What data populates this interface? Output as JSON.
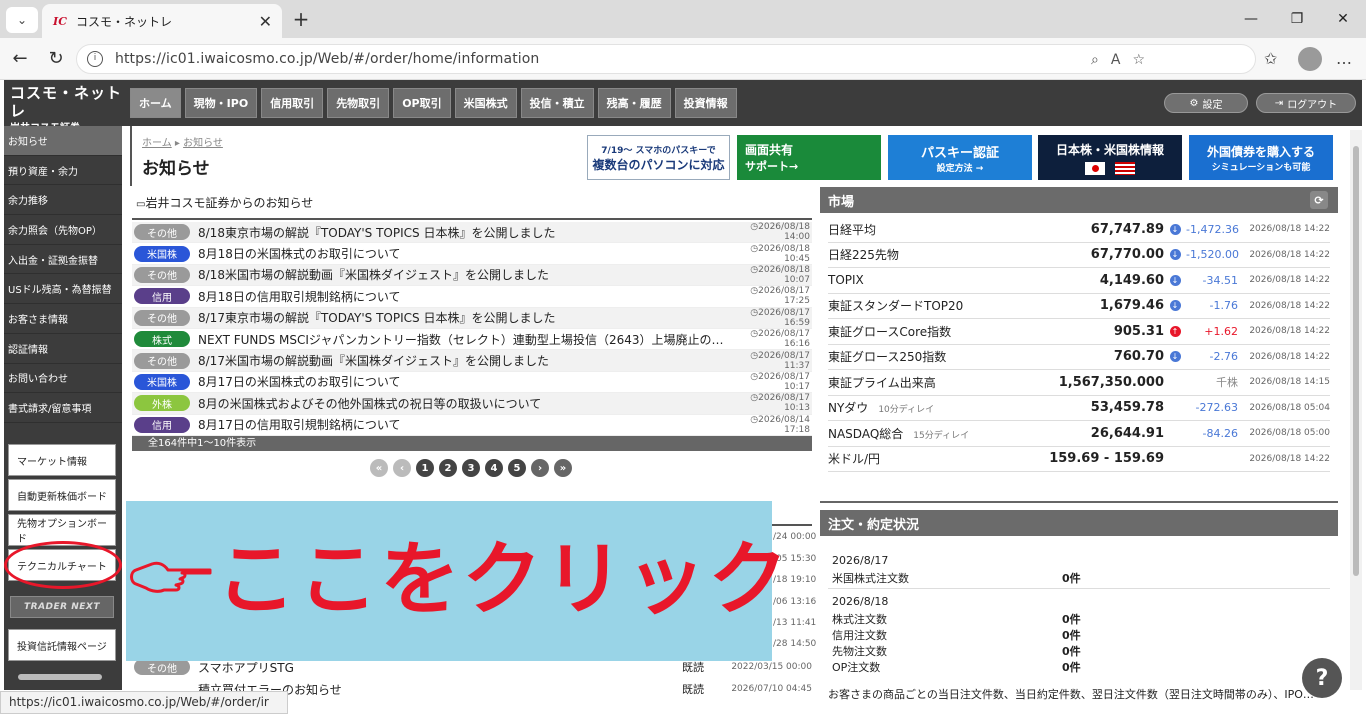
{
  "browser": {
    "tab_title": "コスモ・ネットレ",
    "url": "https://ic01.iwaicosmo.co.jp/Web/#/order/home/information",
    "status_url": "https://ic01.iwaicosmo.co.jp/Web/#/order/ir"
  },
  "header": {
    "logo_line1": "コスモ・ネットレ",
    "logo_line2": "岩井コスモ証券",
    "nav": [
      "ホーム",
      "現物・IPO",
      "信用取引",
      "先物取引",
      "OP取引",
      "米国株式",
      "投信・積立",
      "残高・履歴",
      "投資情報"
    ],
    "settings_label": "設定",
    "logout_label": "ログアウト"
  },
  "sidebar": {
    "items": [
      "お知らせ",
      "預り資産・余力",
      "余力推移",
      "余力照会（先物OP）",
      "入出金・証拠金振替",
      "USドル残高・為替振替",
      "お客さま情報",
      "認証情報",
      "お問い合わせ",
      "書式請求/留意事項"
    ],
    "buttons": [
      "マーケット情報",
      "自動更新株価ボード",
      "先物オプションボード",
      "テクニカルチャート"
    ],
    "trader_next": "TRADER NEXT",
    "fund_button": "投資信託情報ページ"
  },
  "main": {
    "breadcrumb_home": "ホーム",
    "breadcrumb_current": "お知らせ",
    "page_title": "お知らせ",
    "section_title": "岩井コスモ証券からのお知らせ",
    "banners": [
      {
        "l1": "7/19〜 スマホのパスキーで",
        "l2": "複数台のパソコンに対応"
      },
      {
        "l1": "画面共有",
        "l2": "サポート→"
      },
      {
        "l1": "パスキー認証",
        "l2": "設定方法 →"
      },
      {
        "l1": "日本株・米国株情報",
        "l2": ""
      },
      {
        "l1": "外国債券を購入する",
        "l2": "シミュレーションも可能"
      }
    ],
    "news": [
      {
        "badge": "その他",
        "color": "#9a9a9a",
        "title": "8/18東京市場の解説『TODAY'S TOPICS 日本株』を公開しました",
        "date": "2026/08/18 14:00"
      },
      {
        "badge": "米国株",
        "color": "#2a56d8",
        "title": "8月18日の米国株式のお取引について",
        "date": "2026/08/18 10:45"
      },
      {
        "badge": "その他",
        "color": "#9a9a9a",
        "title": "8/18米国市場の解説動画『米国株ダイジェスト』を公開しました",
        "date": "2026/08/18 10:07"
      },
      {
        "badge": "信用",
        "color": "#5a3f8a",
        "title": "8月18日の信用取引規制銘柄について",
        "date": "2026/08/17 17:25"
      },
      {
        "badge": "その他",
        "color": "#9a9a9a",
        "title": "8/17東京市場の解説『TODAY'S TOPICS 日本株』を公開しました",
        "date": "2026/08/17 16:59"
      },
      {
        "badge": "株式",
        "color": "#1f8a3a",
        "title": "NEXT FUNDS MSCIジャパンカントリー指数（セレクト）連動型上場投信（2643）上場廃止の…",
        "date": "2026/08/17 16:16"
      },
      {
        "badge": "その他",
        "color": "#9a9a9a",
        "title": "8/17米国市場の解説動画『米国株ダイジェスト』を公開しました",
        "date": "2026/08/17 11:37"
      },
      {
        "badge": "米国株",
        "color": "#2a56d8",
        "title": "8月17日の米国株式のお取引について",
        "date": "2026/08/17 10:17"
      },
      {
        "badge": "外株",
        "color": "#8cc63f",
        "title": "8月の米国株式およびその他外国株式の祝日等の取扱いについて",
        "date": "2026/08/17 10:13"
      },
      {
        "badge": "信用",
        "color": "#5a3f8a",
        "title": "8月17日の信用取引規制銘柄について",
        "date": "2026/08/14 17:18"
      }
    ],
    "count_text": "全164件中1〜10件表示",
    "pages": [
      "«",
      "‹",
      "1",
      "2",
      "3",
      "4",
      "5",
      "›",
      "»"
    ],
    "partial_dates": [
      "/24 00:00",
      "/05 15:30",
      "/18 19:10",
      "/06 13:16",
      "/13 11:41",
      "/28 14:50"
    ],
    "lower_news": [
      {
        "badge": "その他",
        "title": "スマホアプリSTG",
        "read": "既読",
        "date": "2022/03/15 00:00"
      },
      {
        "badge": "",
        "title": "積立買付エラーのお知らせ",
        "read": "既読",
        "date": "2026/07/10 04:45"
      }
    ]
  },
  "overlay": {
    "text": "ここをクリック"
  },
  "market": {
    "title": "市場",
    "rows": [
      {
        "name": "日経平均",
        "note": "",
        "value": "67,747.89",
        "dir": "down",
        "change": "-1,472.36",
        "time": "2026/08/18 14:22"
      },
      {
        "name": "日経225先物",
        "note": "",
        "value": "67,770.00",
        "dir": "down",
        "change": "-1,520.00",
        "time": "2026/08/18 14:22"
      },
      {
        "name": "TOPIX",
        "note": "",
        "value": "4,149.60",
        "dir": "down",
        "change": "-34.51",
        "time": "2026/08/18 14:22"
      },
      {
        "name": "東証スタンダードTOP20",
        "note": "",
        "value": "1,679.46",
        "dir": "down",
        "change": "-1.76",
        "time": "2026/08/18 14:22"
      },
      {
        "name": "東証グロースCore指数",
        "note": "",
        "value": "905.31",
        "dir": "up",
        "change": "+1.62",
        "time": "2026/08/18 14:22"
      },
      {
        "name": "東証グロース250指数",
        "note": "",
        "value": "760.70",
        "dir": "down",
        "change": "-2.76",
        "time": "2026/08/18 14:22"
      },
      {
        "name": "東証プライム出来高",
        "note": "",
        "value": "1,567,350.000",
        "dir": "",
        "change": "千株",
        "time": "2026/08/18 14:15"
      },
      {
        "name": "NYダウ",
        "note": "10分ディレイ",
        "value": "53,459.78",
        "dir": "",
        "change": "-272.63",
        "time": "2026/08/18 05:04"
      },
      {
        "name": "NASDAQ総合",
        "note": "15分ディレイ",
        "value": "26,644.91",
        "dir": "",
        "change": "-84.26",
        "time": "2026/08/18 05:00"
      },
      {
        "name": "米ドル/円",
        "note": "",
        "value": "159.69 - 159.69",
        "dir": "",
        "change": "",
        "time": "2026/08/18 14:22"
      }
    ]
  },
  "orders": {
    "title": "注文・約定状況",
    "date1": "2026/8/17",
    "date1_rows": [
      {
        "label": "米国株式注文数",
        "value": "0件"
      }
    ],
    "date2": "2026/8/18",
    "date2_rows": [
      {
        "label": "株式注文数",
        "value": "0件"
      },
      {
        "label": "信用注文数",
        "value": "0件"
      },
      {
        "label": "先物注文数",
        "value": "0件"
      },
      {
        "label": "OP注文数",
        "value": "0件"
      }
    ],
    "note": "お客さまの商品ごとの当日注文件数、当日約定件数、翌日注文件数（翌日注文時間帯のみ）、IPO…"
  },
  "colors": {
    "accent_red": "#e8172a",
    "header_dark": "#3c3c3c",
    "overlay_blue": "#99d4e7",
    "up_red": "#e8172a",
    "down_blue": "#4a78d6"
  }
}
